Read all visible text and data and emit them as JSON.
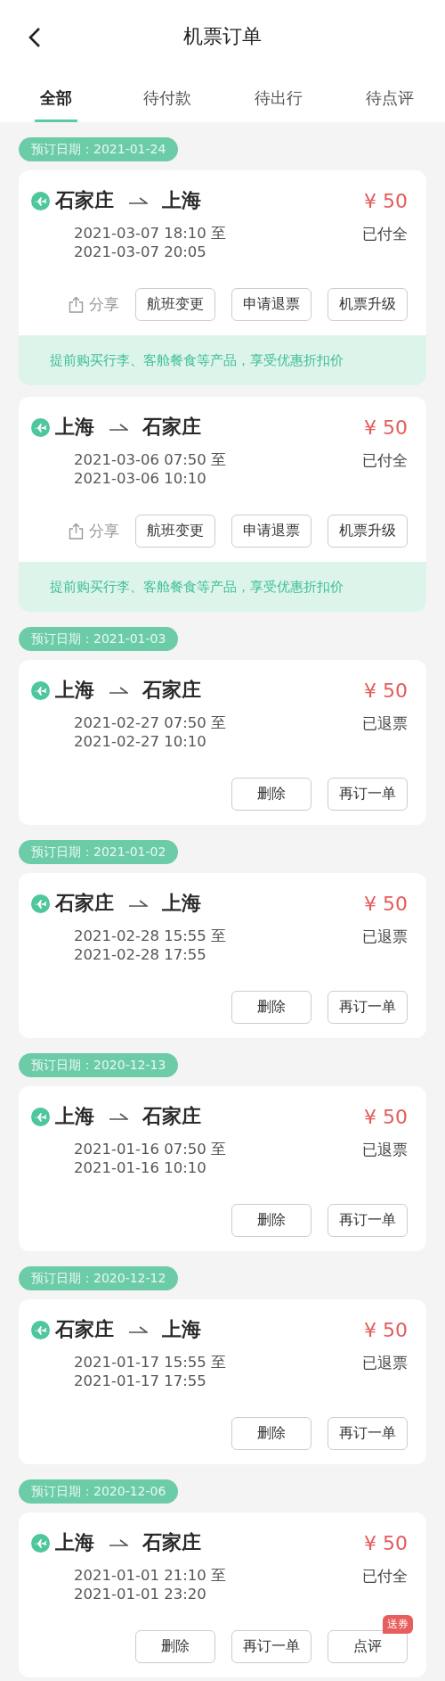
{
  "header": {
    "title": "机票订单"
  },
  "tabs": [
    {
      "label": "全部",
      "selected": true
    },
    {
      "label": "待付款",
      "selected": false
    },
    {
      "label": "待出行",
      "selected": false
    },
    {
      "label": "待点评",
      "selected": false
    }
  ],
  "orders": [
    {
      "booking_date": "预订日期：2021-01-24",
      "from": "石家庄",
      "to": "上海",
      "depart": "2021-03-07 18:10 至",
      "arrive": "2021-03-07 20:05",
      "price": "¥ 50",
      "status": "已付全",
      "share": "分享",
      "actions": [
        {
          "label": "航班变更"
        },
        {
          "label": "申请退票"
        },
        {
          "label": "机票升级"
        }
      ],
      "promo": "提前购买行李、客舱餐食等产品，享受优惠折扣价"
    },
    {
      "from": "上海",
      "to": "石家庄",
      "depart": "2021-03-06 07:50 至",
      "arrive": "2021-03-06 10:10",
      "price": "¥ 50",
      "status": "已付全",
      "share": "分享",
      "actions": [
        {
          "label": "航班变更"
        },
        {
          "label": "申请退票"
        },
        {
          "label": "机票升级"
        }
      ],
      "promo": "提前购买行李、客舱餐食等产品，享受优惠折扣价"
    },
    {
      "booking_date": "预订日期：2021-01-03",
      "from": "上海",
      "to": "石家庄",
      "depart": "2021-02-27 07:50 至",
      "arrive": "2021-02-27 10:10",
      "price": "¥ 50",
      "status": "已退票",
      "actions": [
        {
          "label": "删除"
        },
        {
          "label": "再订一单"
        }
      ]
    },
    {
      "booking_date": "预订日期：2021-01-02",
      "from": "石家庄",
      "to": "上海",
      "depart": "2021-02-28 15:55 至",
      "arrive": "2021-02-28 17:55",
      "price": "¥ 50",
      "status": "已退票",
      "actions": [
        {
          "label": "删除"
        },
        {
          "label": "再订一单"
        }
      ]
    },
    {
      "booking_date": "预订日期：2020-12-13",
      "from": "上海",
      "to": "石家庄",
      "depart": "2021-01-16 07:50 至",
      "arrive": "2021-01-16 10:10",
      "price": "¥ 50",
      "status": "已退票",
      "actions": [
        {
          "label": "删除"
        },
        {
          "label": "再订一单"
        }
      ]
    },
    {
      "booking_date": "预订日期：2020-12-12",
      "from": "石家庄",
      "to": "上海",
      "depart": "2021-01-17 15:55 至",
      "arrive": "2021-01-17 17:55",
      "price": "¥ 50",
      "status": "已退票",
      "actions": [
        {
          "label": "删除"
        },
        {
          "label": "再订一单"
        }
      ]
    },
    {
      "booking_date": "预订日期：2020-12-06",
      "from": "上海",
      "to": "石家庄",
      "depart": "2021-01-01 21:10 至",
      "arrive": "2021-01-01 23:20",
      "price": "¥ 50",
      "status": "已付全",
      "actions": [
        {
          "label": "删除"
        },
        {
          "label": "再订一单"
        },
        {
          "label": "点评",
          "badge": "送券"
        }
      ]
    }
  ]
}
